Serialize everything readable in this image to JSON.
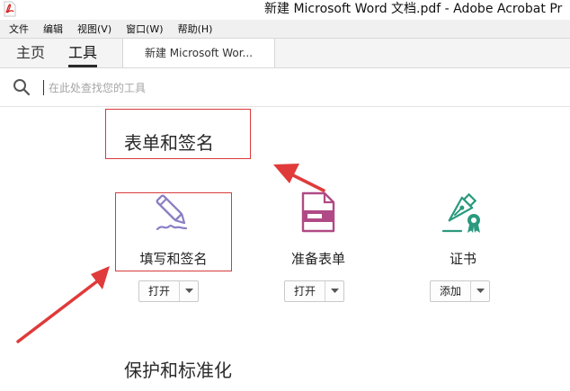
{
  "window": {
    "title": "新建 Microsoft Word 文档.pdf - Adobe Acrobat Pr"
  },
  "menubar": {
    "items": [
      "文件",
      "编辑",
      "视图(V)",
      "窗口(W)",
      "帮助(H)"
    ]
  },
  "tabs": {
    "home": "主页",
    "tools": "工具",
    "document": "新建 Microsoft Wor..."
  },
  "search": {
    "placeholder": "在此处查找您的工具",
    "value": ""
  },
  "sections": [
    {
      "title": "表单和签名",
      "tools": [
        {
          "label": "填写和签名",
          "button": "打开",
          "icon": "pen-sign-icon"
        },
        {
          "label": "准备表单",
          "button": "打开",
          "icon": "form-icon"
        },
        {
          "label": "证书",
          "button": "添加",
          "icon": "certificate-pen-icon"
        }
      ]
    },
    {
      "title": "保护和标准化"
    }
  ],
  "colors": {
    "annotation": "#d83a3a",
    "sign_icon": "#8c7fc4",
    "form_icon": "#b04a86",
    "cert_icon": "#2a9a7e"
  }
}
